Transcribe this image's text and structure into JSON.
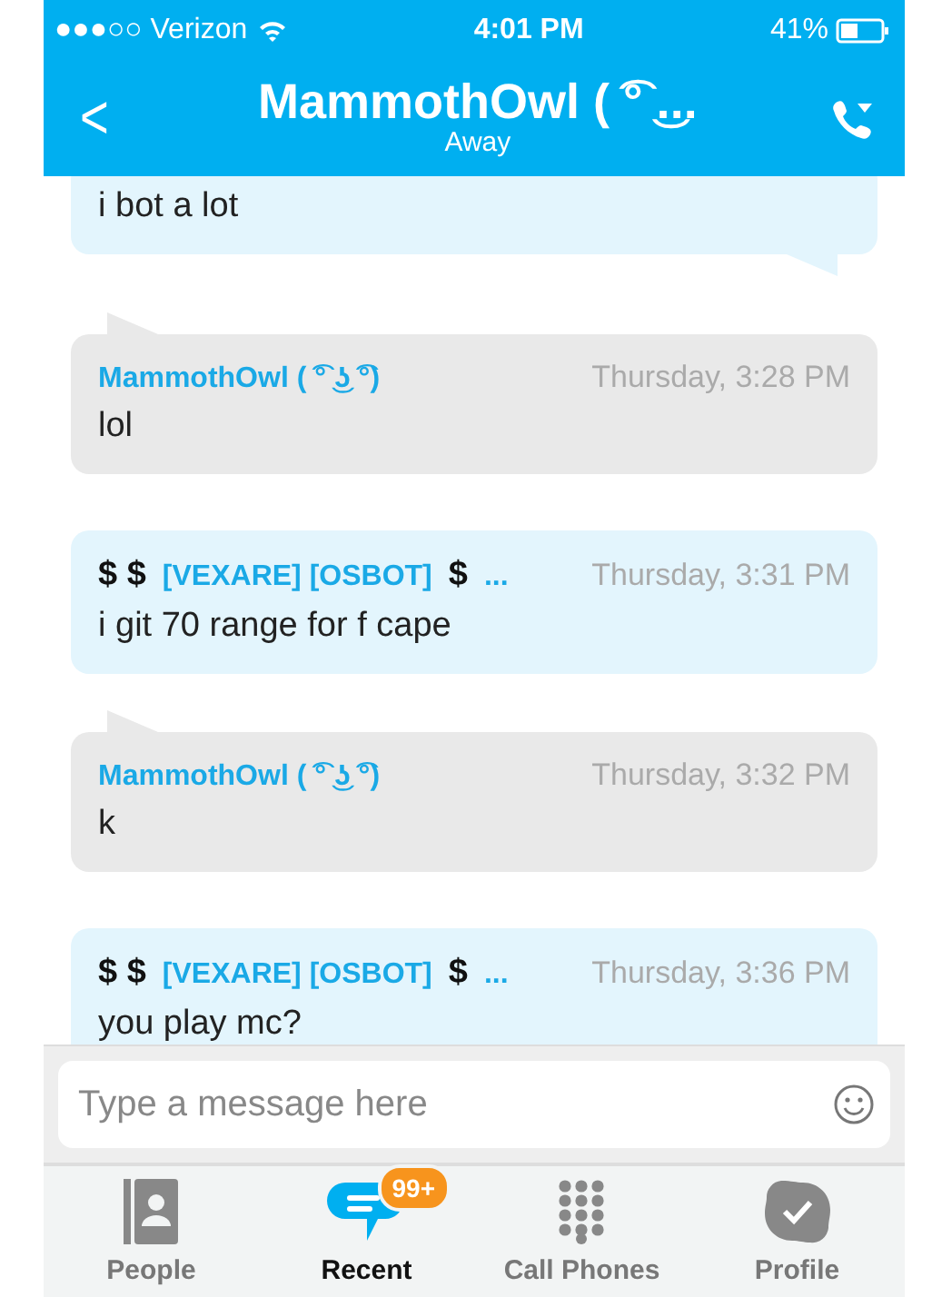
{
  "status_bar": {
    "carrier": "●●●○○ Verizon",
    "time": "4:01 PM",
    "battery": "41%"
  },
  "header": {
    "back": "<",
    "title": "MammothOwl  ( ͡° ͜...",
    "status": "Away"
  },
  "messages": [
    {
      "kind": "outgoing",
      "tail": true,
      "text": "i bot a lot"
    },
    {
      "kind": "incoming",
      "tail": true,
      "sender": [
        {
          "kind": "name",
          "text": "MammothOwl  ( ͡° ͜ʖ ͡°)"
        }
      ],
      "time": "Thursday, 3:28 PM",
      "text": "lol"
    },
    {
      "kind": "outgoing",
      "tail": false,
      "sender": [
        {
          "kind": "symbol",
          "text": "$ $"
        },
        {
          "kind": "name",
          "text": "[VEXARE] [OSBOT]"
        },
        {
          "kind": "symbol",
          "text": "$"
        },
        {
          "kind": "name",
          "text": "..."
        }
      ],
      "time": "Thursday, 3:31 PM",
      "text": "i git 70 range for f cape"
    },
    {
      "kind": "incoming",
      "tail": true,
      "sender": [
        {
          "kind": "name",
          "text": "MammothOwl  ( ͡° ͜ʖ ͡°)"
        }
      ],
      "time": "Thursday, 3:32 PM",
      "text": "k"
    },
    {
      "kind": "outgoing",
      "tail": false,
      "sender": [
        {
          "kind": "symbol",
          "text": "$ $"
        },
        {
          "kind": "name",
          "text": "[VEXARE] [OSBOT]"
        },
        {
          "kind": "symbol",
          "text": "$"
        },
        {
          "kind": "name",
          "text": "..."
        }
      ],
      "time": "Thursday, 3:36 PM",
      "text": "you play mc?"
    }
  ],
  "composer": {
    "placeholder": "Type a message here"
  },
  "tabs": [
    {
      "kind": "people",
      "label": "People",
      "selected": false
    },
    {
      "kind": "recent",
      "label": "Recent",
      "selected": true,
      "badge": "99+"
    },
    {
      "kind": "dialpad",
      "label": "Call Phones",
      "selected": false
    },
    {
      "kind": "profile",
      "label": "Profile",
      "selected": false
    }
  ]
}
